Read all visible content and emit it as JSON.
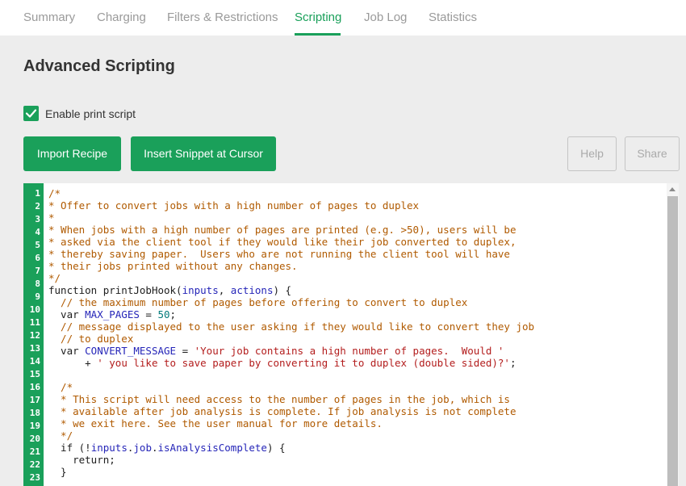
{
  "tabs": [
    "Summary",
    "Charging",
    "Filters & Restrictions",
    "Scripting",
    "Job Log",
    "Statistics"
  ],
  "active_tab": "Scripting",
  "page_title": "Advanced Scripting",
  "enable_print_script": {
    "label": "Enable print script",
    "checked": true
  },
  "buttons": {
    "import_recipe": "Import Recipe",
    "insert_snippet": "Insert Snippet at Cursor",
    "help": "Help",
    "share": "Share"
  },
  "colors": {
    "accent": "#1aa05a",
    "background": "#ededed"
  },
  "editor": {
    "line_numbers": [
      "1",
      "2",
      "3",
      "4",
      "5",
      "6",
      "7",
      "8",
      "9",
      "10",
      "11",
      "12",
      "13",
      "14",
      "15",
      "16",
      "17",
      "18",
      "19",
      "20",
      "21",
      "22",
      "23"
    ],
    "lines": [
      [
        {
          "t": "/*",
          "c": "cm"
        }
      ],
      [
        {
          "t": "* Offer to convert jobs with a high number of pages to duplex",
          "c": "cm"
        }
      ],
      [
        {
          "t": "*",
          "c": "cm"
        }
      ],
      [
        {
          "t": "* When jobs with a high number of pages are printed (e.g. >50), users will be",
          "c": "cm"
        }
      ],
      [
        {
          "t": "* asked via the client tool if they would like their job converted to duplex,",
          "c": "cm"
        }
      ],
      [
        {
          "t": "* thereby saving paper.  Users who are not running the client tool will have",
          "c": "cm"
        }
      ],
      [
        {
          "t": "* their jobs printed without any changes.",
          "c": "cm"
        }
      ],
      [
        {
          "t": "*/",
          "c": "cm"
        }
      ],
      [
        {
          "t": "function ",
          "c": "kw"
        },
        {
          "t": "printJobHook",
          "c": "pl"
        },
        {
          "t": "(",
          "c": "pl"
        },
        {
          "t": "inputs",
          "c": "va"
        },
        {
          "t": ", ",
          "c": "pl"
        },
        {
          "t": "actions",
          "c": "va"
        },
        {
          "t": ") {",
          "c": "pl"
        }
      ],
      [
        {
          "t": "  // the maximum number of pages before offering to convert to duplex",
          "c": "cm"
        }
      ],
      [
        {
          "t": "  var ",
          "c": "kw"
        },
        {
          "t": "MAX_PAGES",
          "c": "va"
        },
        {
          "t": " = ",
          "c": "pl"
        },
        {
          "t": "50",
          "c": "nm"
        },
        {
          "t": ";",
          "c": "pl"
        }
      ],
      [
        {
          "t": "  // message displayed to the user asking if they would like to convert they job",
          "c": "cm"
        }
      ],
      [
        {
          "t": "  // to duplex",
          "c": "cm"
        }
      ],
      [
        {
          "t": "  var ",
          "c": "kw"
        },
        {
          "t": "CONVERT_MESSAGE",
          "c": "va"
        },
        {
          "t": " = ",
          "c": "pl"
        },
        {
          "t": "'Your job contains a high number of pages.  Would '",
          "c": "st"
        }
      ],
      [
        {
          "t": "      + ",
          "c": "pl"
        },
        {
          "t": "' you like to save paper by converting it to duplex (double sided)?'",
          "c": "st"
        },
        {
          "t": ";",
          "c": "pl"
        }
      ],
      [
        {
          "t": "",
          "c": "pl"
        }
      ],
      [
        {
          "t": "  /*",
          "c": "cm"
        }
      ],
      [
        {
          "t": "  * This script will need access to the number of pages in the job, which is",
          "c": "cm"
        }
      ],
      [
        {
          "t": "  * available after job analysis is complete. If job analysis is not complete",
          "c": "cm"
        }
      ],
      [
        {
          "t": "  * we exit here. See the user manual for more details.",
          "c": "cm"
        }
      ],
      [
        {
          "t": "  */",
          "c": "cm"
        }
      ],
      [
        {
          "t": "  if ",
          "c": "kw"
        },
        {
          "t": "(!",
          "c": "pl"
        },
        {
          "t": "inputs",
          "c": "va"
        },
        {
          "t": ".",
          "c": "pl"
        },
        {
          "t": "job",
          "c": "va"
        },
        {
          "t": ".",
          "c": "pl"
        },
        {
          "t": "isAnalysisComplete",
          "c": "va"
        },
        {
          "t": ") {",
          "c": "pl"
        }
      ],
      [
        {
          "t": "    return",
          "c": "kw"
        },
        {
          "t": ";",
          "c": "pl"
        }
      ],
      [
        {
          "t": "  }",
          "c": "pl"
        }
      ]
    ]
  }
}
